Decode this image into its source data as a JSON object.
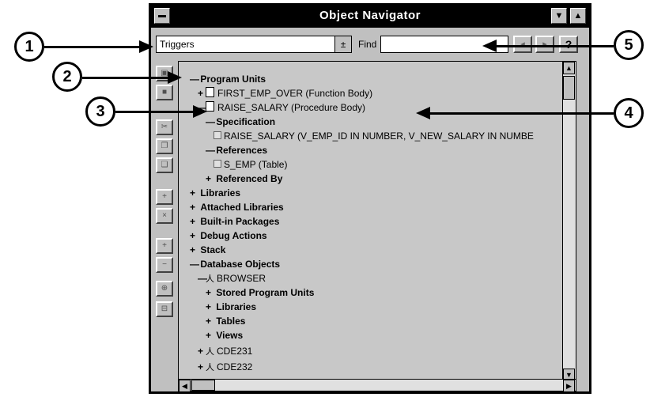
{
  "window": {
    "title": "Object Navigator"
  },
  "toolbar": {
    "combo_value": "Triggers",
    "combo_arrow": "±",
    "find_label": "Find",
    "find_value": "",
    "help_label": "?"
  },
  "tree": {
    "program_units": "Program Units",
    "first_emp_over": "FIRST_EMP_OVER (Function Body)",
    "raise_salary": "RAISE_SALARY (Procedure Body)",
    "specification": "Specification",
    "spec_signature": "RAISE_SALARY (V_EMP_ID IN NUMBER, V_NEW_SALARY IN NUMBE",
    "references": "References",
    "s_emp": "S_EMP (Table)",
    "referenced_by": "Referenced By",
    "libraries": "Libraries",
    "attached_libraries": "Attached Libraries",
    "builtin_packages": "Built-in Packages",
    "debug_actions": "Debug Actions",
    "stack": "Stack",
    "database_objects": "Database Objects",
    "browser": "BROWSER",
    "stored_program_units": "Stored Program Units",
    "libraries2": "Libraries",
    "tables": "Tables",
    "views": "Views",
    "cde231": "CDE231",
    "cde232": "CDE232"
  },
  "callouts": [
    "1",
    "2",
    "3",
    "4",
    "5"
  ],
  "icons": {
    "collapse": "—",
    "expand": "+"
  }
}
